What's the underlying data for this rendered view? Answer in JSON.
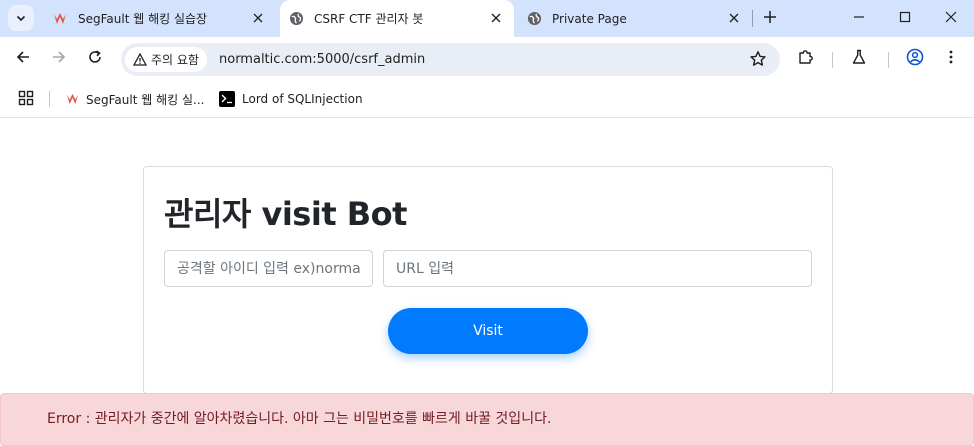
{
  "tabs": [
    {
      "title": "SegFault 웹 해킹 실습장",
      "active": false,
      "favicon": "segfault-logo-icon"
    },
    {
      "title": "CSRF CTF 관리자 봇",
      "active": true,
      "favicon": "globe-icon"
    },
    {
      "title": "Private Page",
      "active": false,
      "favicon": "globe-icon"
    }
  ],
  "toolbar": {
    "security_chip": "주의 요함",
    "url": "normaltic.com:5000/csrf_admin"
  },
  "bookmarks": [
    {
      "label": "SegFault 웹 해킹 실...",
      "icon": "segfault-logo-icon"
    },
    {
      "label": "Lord of SQLInjection",
      "icon": "terminal-icon"
    }
  ],
  "page": {
    "title_regular": "관리자",
    "title_bold": "visit Bot",
    "id_placeholder": "공격할 아이디 입력 ex)normaltic",
    "url_placeholder": "URL 입력",
    "visit_label": "Visit",
    "error_message": "Error : 관리자가 중간에 알아차렸습니다. 아마 그는 비밀번호를 빠르게 바꿀 것입니다."
  },
  "colors": {
    "tabstrip": "#d3e3fd",
    "primary_button": "#007bff",
    "alert_bg": "#f8d7da",
    "alert_text": "#721c24"
  }
}
